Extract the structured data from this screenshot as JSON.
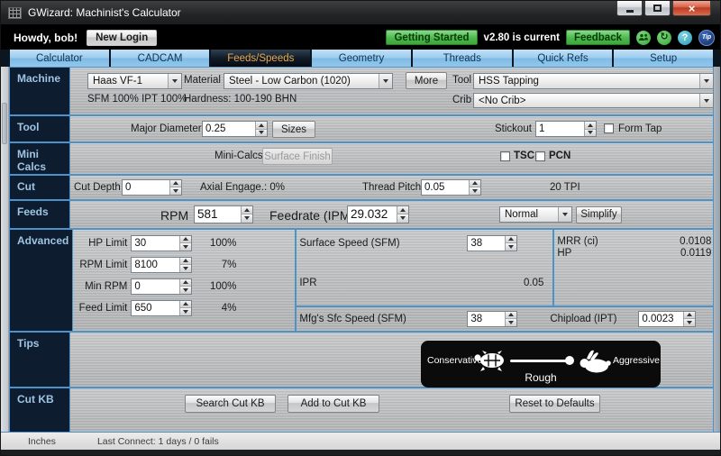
{
  "colors": {
    "accent_blue": "#4E93C8",
    "sidebar_bg": "#0D1C2E",
    "active_tab_text": "#E8A94F",
    "green_button": "#4CB84C",
    "help_circle": "#2E9CB8",
    "tip_circle": "#12295E",
    "close_button": "#C23B22"
  },
  "window": {
    "title": "GWizard: Machinist's Calculator"
  },
  "header": {
    "greeting": "Howdy, bob!",
    "new_login": "New Login",
    "getting_started": "Getting Started",
    "version": "v2.80 is current",
    "feedback": "Feedback",
    "refresh_glyph": "↻",
    "help_glyph": "?",
    "tip": "Tip"
  },
  "tabs": [
    {
      "label": "Calculator",
      "active": false
    },
    {
      "label": "CADCAM",
      "active": false
    },
    {
      "label": "Feeds/Speeds",
      "active": true
    },
    {
      "label": "Geometry",
      "active": false
    },
    {
      "label": "Threads",
      "active": false
    },
    {
      "label": "Quick Refs",
      "active": false
    },
    {
      "label": "Setup",
      "active": false
    }
  ],
  "machine": {
    "section_label": "Machine",
    "machine_value": "Haas VF-1",
    "material_label": "Material",
    "material_value": "Steel - Low Carbon (1020)",
    "more": "More",
    "tool_label": "Tool",
    "tool_value": "HSS Tapping",
    "sfm_ipt": "SFM 100% IPT 100%",
    "hardness": "Hardness: 100-190 BHN",
    "crib_label": "Crib",
    "crib_value": "<No Crib>"
  },
  "tool": {
    "section_label": "Tool",
    "major_diameter_label": "Major Diameter",
    "major_diameter": "0.25",
    "sizes": "Sizes",
    "stickout_label": "Stickout",
    "stickout": "1",
    "form_tap": "Form Tap"
  },
  "mini_calcs": {
    "section_label": "Mini Calcs",
    "label": "Mini-Calcs",
    "surface_finish": "Surface Finish",
    "tsc": "TSC",
    "pcn": "PCN"
  },
  "cut": {
    "section_label": "Cut",
    "cut_depth_label": "Cut Depth",
    "cut_depth": "0",
    "axial_engage": "Axial Engage.: 0%",
    "thread_pitch_label": "Thread Pitch",
    "thread_pitch": "0.05",
    "tpi": "20 TPI"
  },
  "feeds": {
    "section_label": "Feeds",
    "rpm_label": "RPM",
    "rpm": "581",
    "feedrate_label": "Feedrate (IPM)",
    "feedrate": "29.032",
    "mode": "Normal",
    "simplify": "Simplify"
  },
  "advanced": {
    "section_label": "Advanced",
    "limits": [
      {
        "label": "HP Limit",
        "value": "30",
        "pct": "100%"
      },
      {
        "label": "RPM Limit",
        "value": "8100",
        "pct": "7%"
      },
      {
        "label": "Min RPM",
        "value": "0",
        "pct": "100%"
      },
      {
        "label": "Feed Limit",
        "value": "650",
        "pct": "4%"
      }
    ],
    "surface_speed_label": "Surface Speed (SFM)",
    "surface_speed": "38",
    "ipr_label": "IPR",
    "ipr": "0.05",
    "mrr_label": "MRR (ci)",
    "mrr": "0.0108",
    "hp_label": "HP",
    "hp": "0.0119",
    "mfg_label": "Mfg's Sfc Speed (SFM)",
    "mfg_sfc_speed": "38",
    "chipload_label": "Chipload (IPT)",
    "chipload": "0.0023"
  },
  "tips": {
    "section_label": "Tips",
    "conservative": "Conservative",
    "aggressive": "Aggressive",
    "mode": "Rough"
  },
  "cut_kb": {
    "section_label": "Cut KB",
    "search": "Search Cut KB",
    "add": "Add to Cut KB",
    "reset": "Reset to Defaults"
  },
  "status": {
    "units": "Inches",
    "last_connect": "Last Connect: 1 days / 0 fails"
  }
}
